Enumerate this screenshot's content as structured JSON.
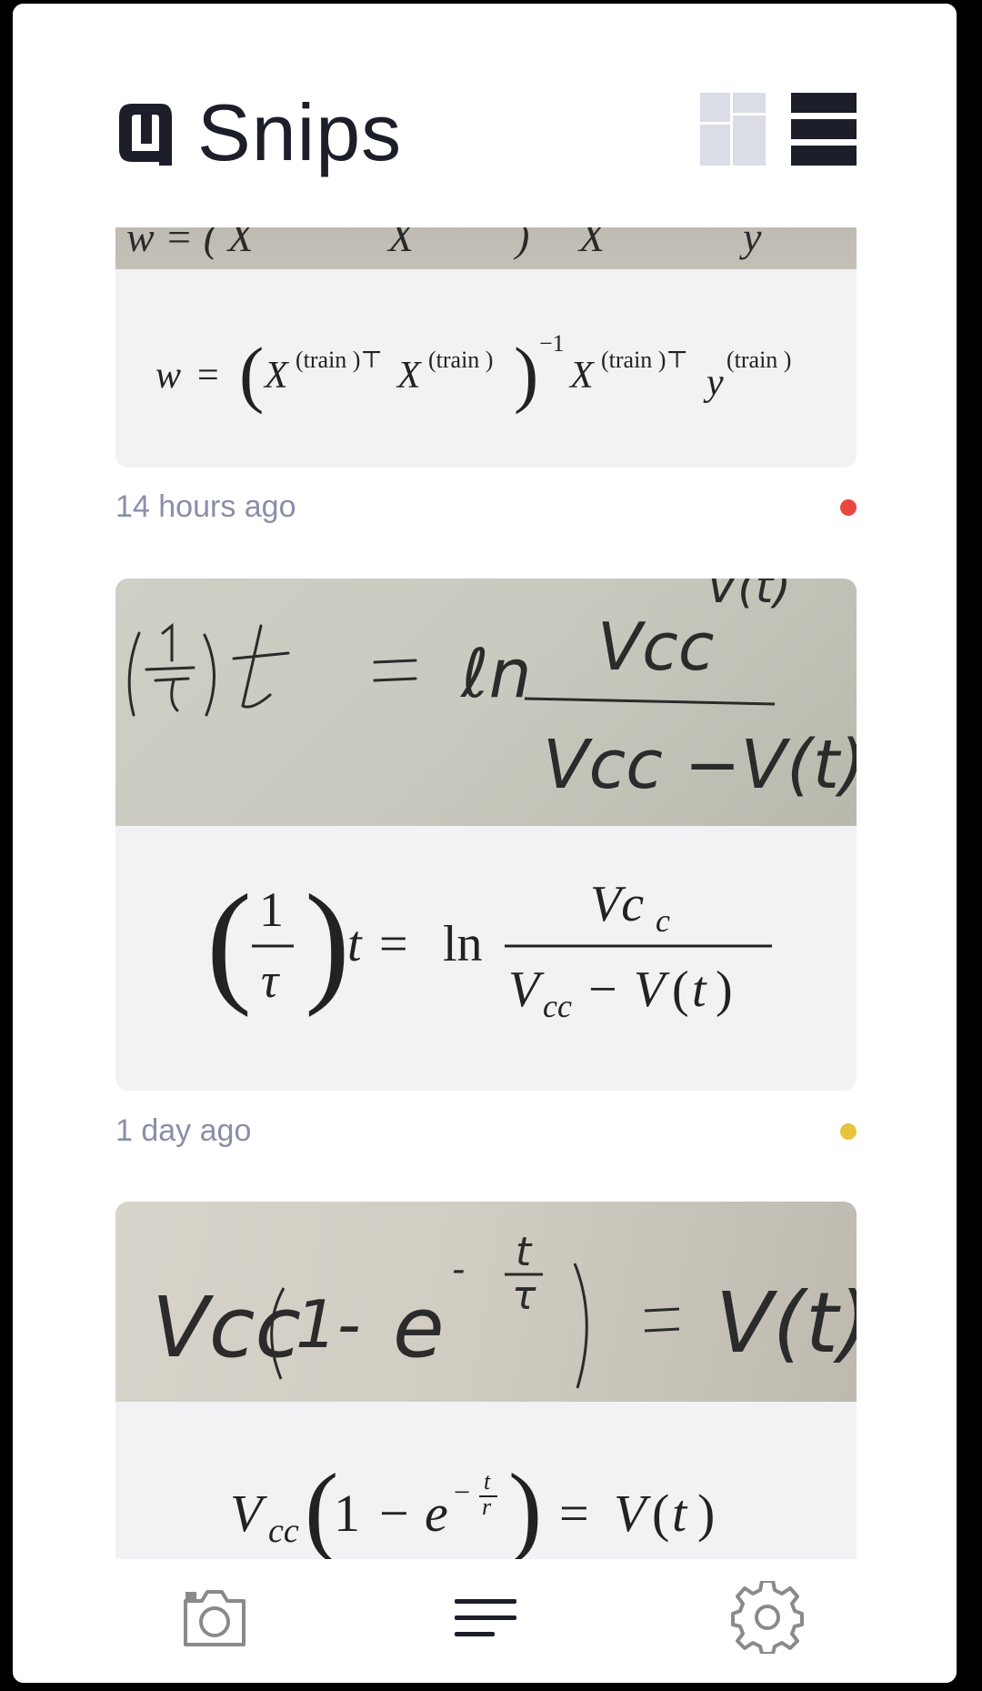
{
  "app": {
    "name": "Snips"
  },
  "header": {
    "view_options": [
      "grid-view",
      "list-view"
    ],
    "active_view": "list-view"
  },
  "snips": [
    {
      "equation": "w = (X^(train)⊤ X^(train))^-1 X^(train)⊤ y^(train)",
      "timestamp": "14 hours ago",
      "status_color": "#e8483f"
    },
    {
      "equation": "(1/τ) t = ln Vc_c / (V_cc − V(t))",
      "timestamp": "1 day ago",
      "status_color": "#e8c43a"
    },
    {
      "equation": "V_cc (1 − e^(−t/r)) = V(t)",
      "timestamp": "",
      "status_color": ""
    }
  ],
  "bottom_nav": [
    "camera",
    "snips-list",
    "settings"
  ],
  "colors": {
    "accent_dark": "#1c1f29",
    "muted": "#8a8ea8",
    "card_bg": "#f2f2f5",
    "inactive_tile": "#dadce6"
  }
}
